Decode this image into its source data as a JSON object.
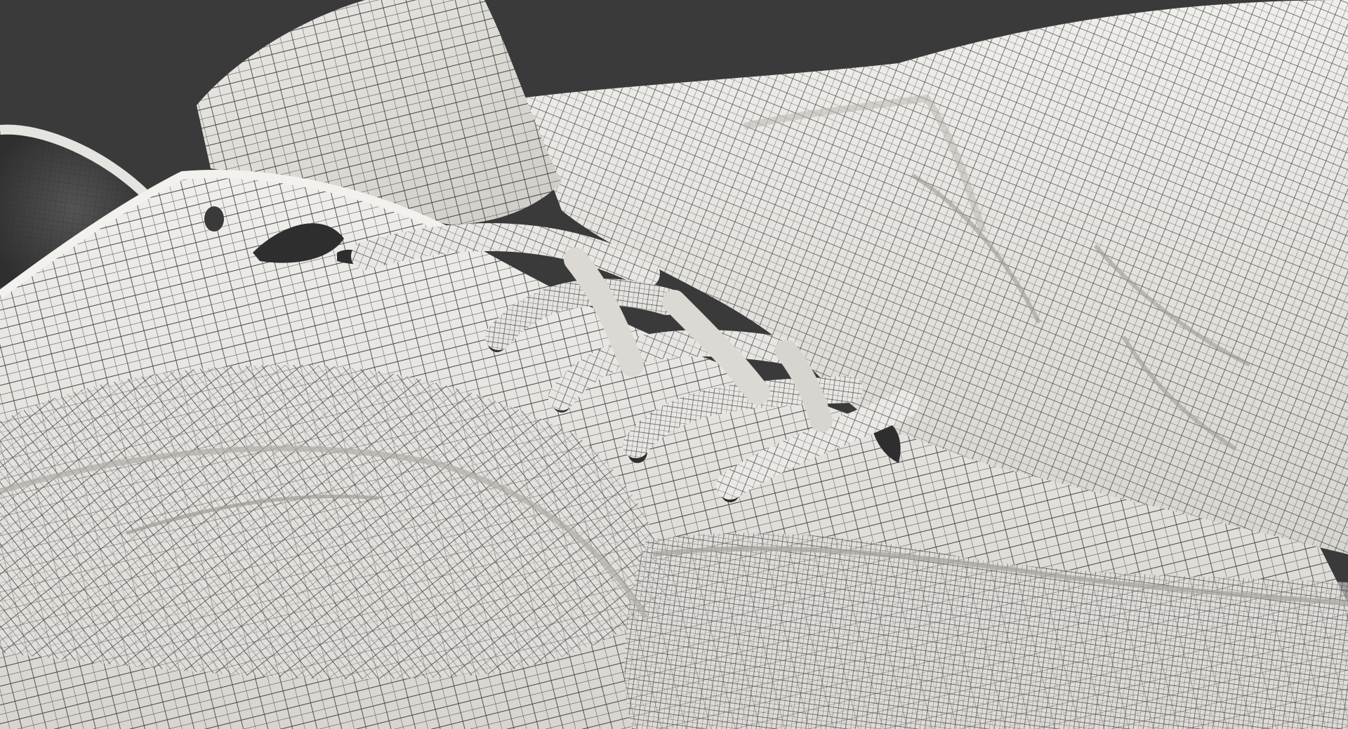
{
  "viewport": {
    "background_color": "#3a3a3a",
    "mesh_fill_color": "#e7e5e2",
    "mesh_shadow_color": "#c9c6c1",
    "wireframe_color": "#2a2a2a",
    "inner_lining_color": "#4a4a4a"
  },
  "scene": {
    "subject": "wireframe-shoe-mesh",
    "display_mode": "wireframe-on-shaded"
  }
}
